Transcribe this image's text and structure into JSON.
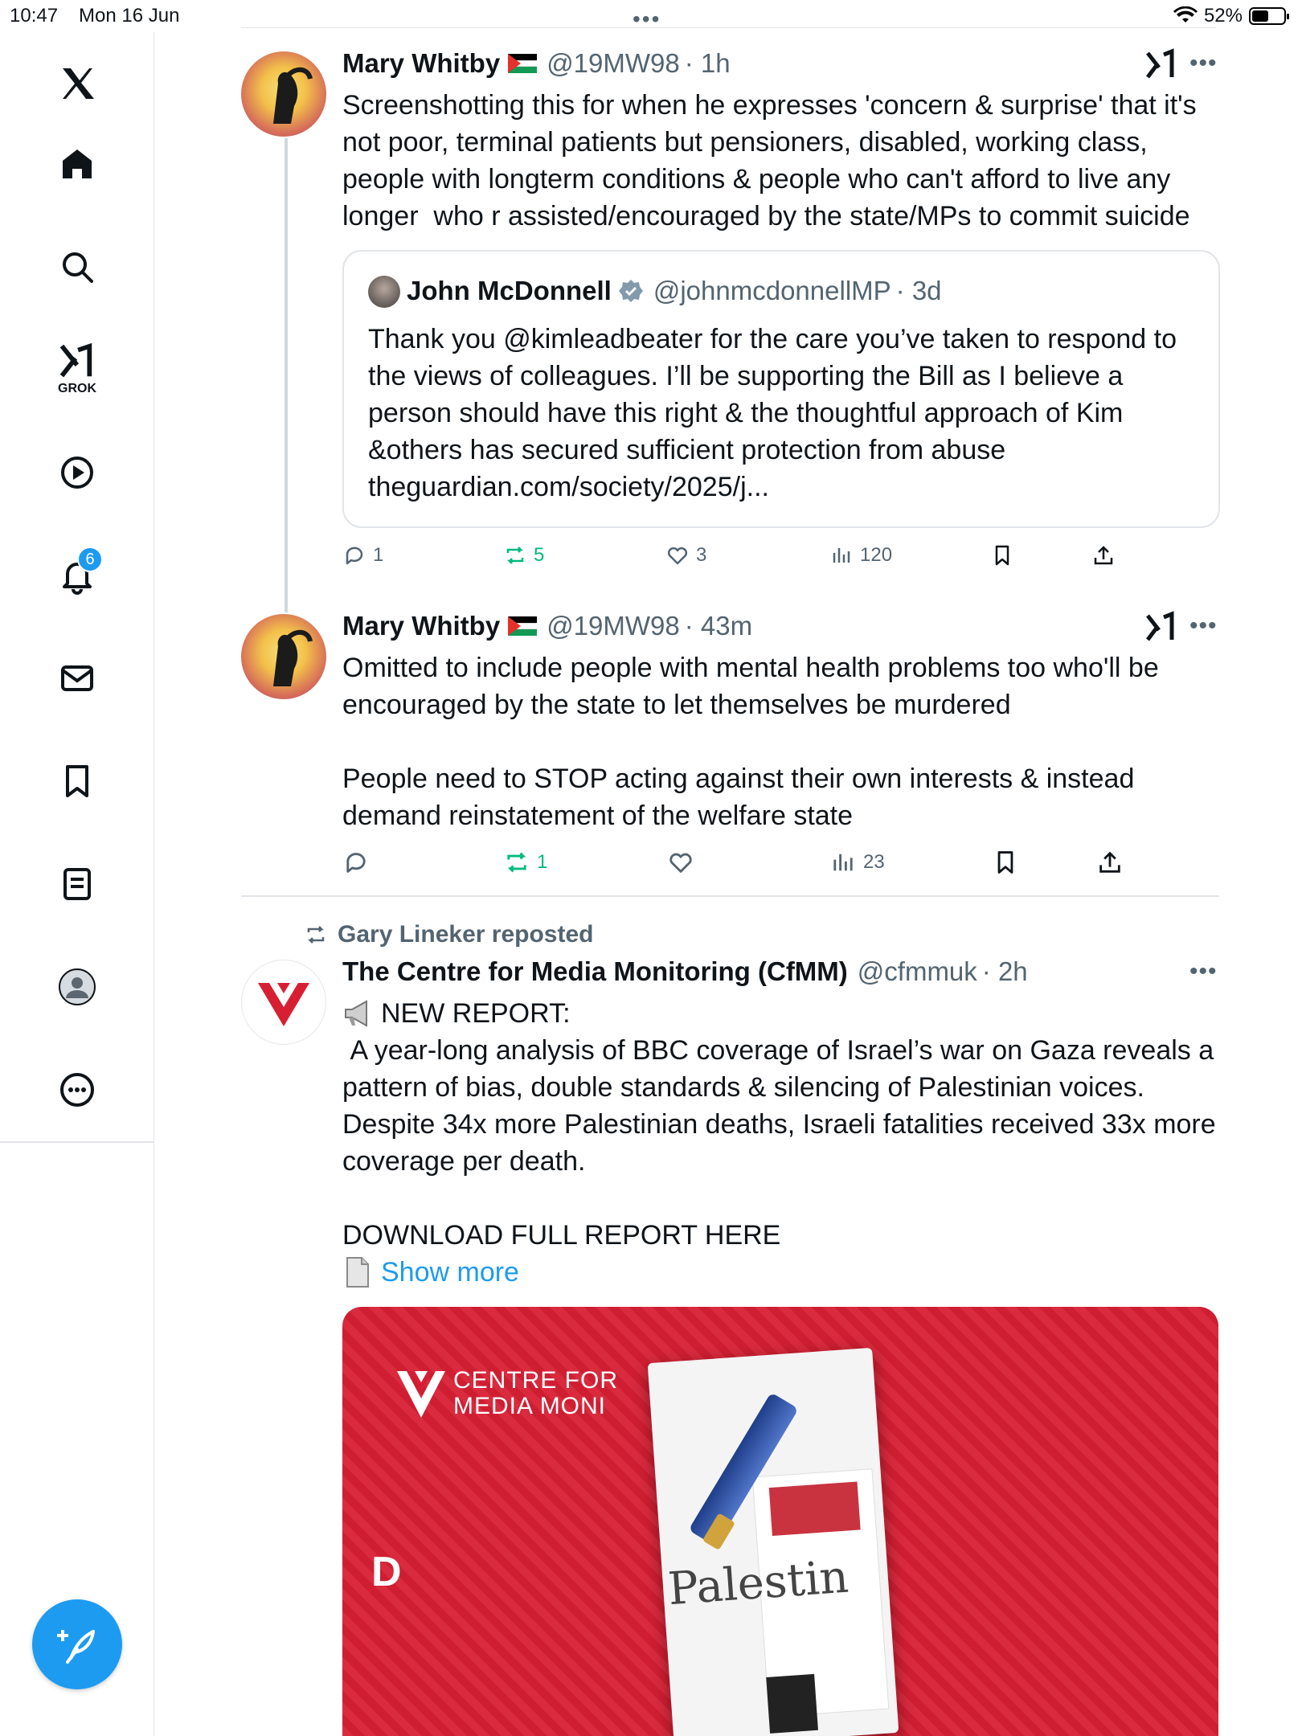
{
  "status_bar": {
    "time": "10:47",
    "date": "Mon 16 Jun",
    "battery": "52%",
    "battery_level": 0.52
  },
  "sidebar": {
    "grok_label": "GROK",
    "notification_count": "6"
  },
  "tweets": [
    {
      "name": "Mary Whitby",
      "handle": "@19MW98",
      "time": "· 1h",
      "text": "Screenshotting this for when he expresses 'concern & surprise' that it's not poor, terminal patients but pensioners, disabled, working class, people with longterm conditions & people who can't afford to live any longer  who r assisted/encouraged by the state/MPs to commit suicide",
      "quote": {
        "name": "John McDonnell",
        "handle": "@johnmcdonnellMP",
        "time": "· 3d",
        "text": "Thank you @kimleadbeater for the care you’ve taken to respond to the views of colleagues. I’ll be supporting the Bill as I believe a person should have this right & the thoughtful approach of Kim &others has secured sufficient protection from abuse theguardian.com/society/2025/j..."
      },
      "replies": "1",
      "reposts": "5",
      "likes": "3",
      "views": "120"
    },
    {
      "name": "Mary Whitby",
      "handle": "@19MW98",
      "time": "· 43m",
      "text": "Omitted to include people with mental health problems too who'll be encouraged by the state to let themselves be murdered\n\nPeople need to STOP acting against their own interests & instead demand reinstatement of the welfare state",
      "replies": "",
      "reposts": "1",
      "likes": "",
      "views": "23"
    },
    {
      "repost_by": "Gary Lineker reposted",
      "name": "The Centre for Media Monitoring (CfMM)",
      "handle": "@cfmmuk",
      "time": "· 2h",
      "text_line1": "NEW REPORT:",
      "text": " A year-long analysis of BBC coverage of Israel’s war on Gaza reveals a pattern of bias, double standards & silencing of Palestinian voices. Despite 34x more Palestinian deaths, Israeli fatalities received 33x more coverage per death.\n\nDOWNLOAD FULL REPORT HERE",
      "show_more": "Show more",
      "media": {
        "brand_line1": "CENTRE FOR",
        "brand_line2": "MEDIA MONI",
        "doc_word": "Palestin",
        "partial_letter": "D"
      }
    }
  ]
}
